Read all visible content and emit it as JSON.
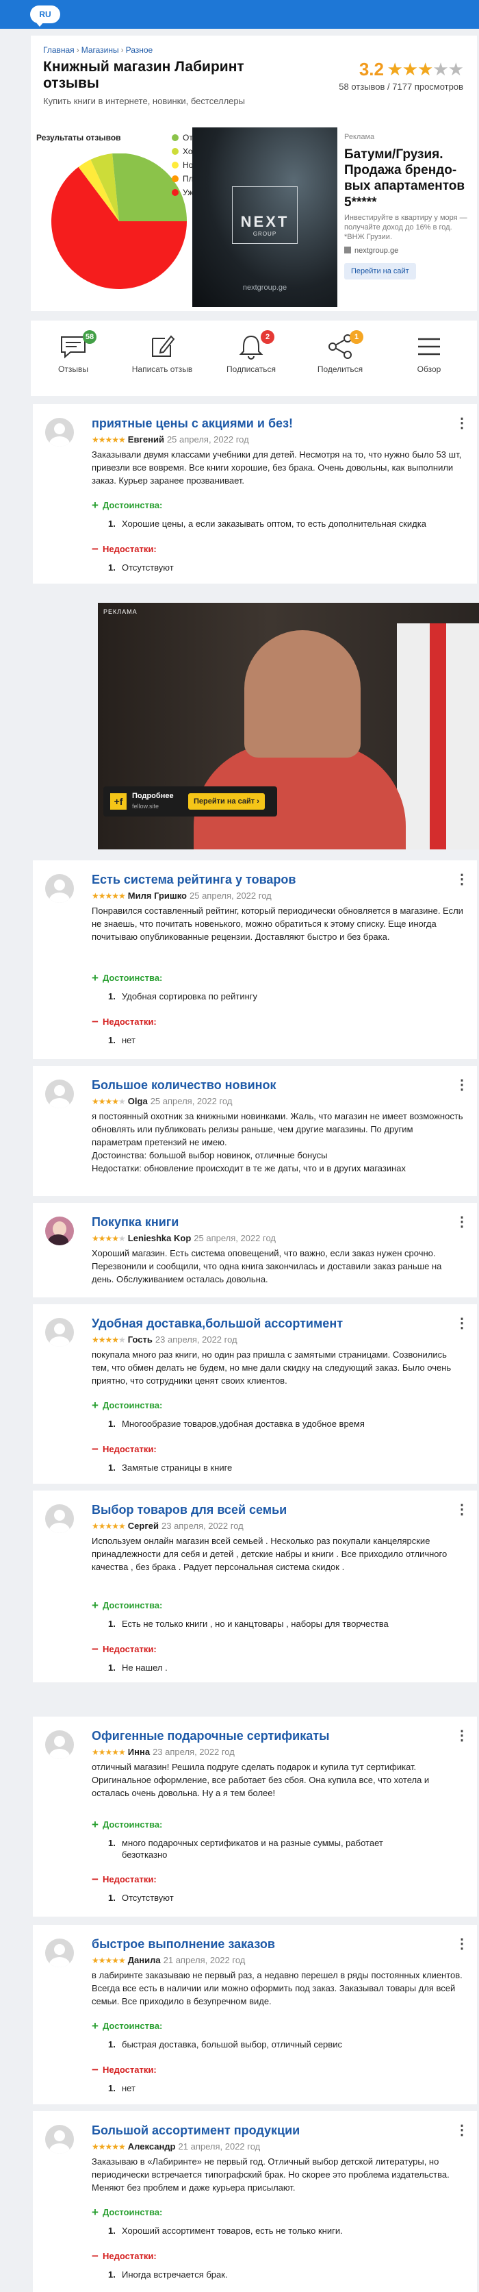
{
  "header": {
    "lang": "RU"
  },
  "store": {
    "breadcrumbs": [
      "Главная",
      "Магазины",
      "Разное"
    ],
    "title": "Книжный магазин Лабиринт отзывы",
    "subtitle": "Купить книги в интернете, новинки, бестселлеры",
    "rating": "3.2",
    "stars": 3,
    "reviews_count": "58 отзывов",
    "views": "7177 просмотров"
  },
  "results": {
    "title": "Результаты отзывов",
    "legend": [
      {
        "label": "Отлично",
        "color": "#8bc34a"
      },
      {
        "label": "Хорошо",
        "color": "#cddc39"
      },
      {
        "label": "Нормально",
        "color": "#ffeb3b"
      },
      {
        "label": "Плохо",
        "color": "#ff9800"
      },
      {
        "label": "Ужасно",
        "color": "#f51d1d"
      }
    ]
  },
  "ad_banner": {
    "label": "Реклама",
    "logo": "NEXT",
    "logo_sub": "GROUP",
    "image_url_text": "nextgroup.ge",
    "headline": "Батуми/Грузия. Продажа брендо­вых апартамен­тов 5*****",
    "body": "Инвестируйте в квартиру у моря — получайте доход до 16% в год. *ВНЖ Грузии.",
    "site": "nextgroup.ge",
    "button": "Перейти на сайт"
  },
  "actions": [
    {
      "label": "Отзывы",
      "icon": "comment-icon",
      "badge": "58",
      "badge_color": "#43a047"
    },
    {
      "label": "Написать отзыв",
      "icon": "pencil-icon"
    },
    {
      "label": "Подписаться",
      "icon": "bell-icon",
      "badge": "2",
      "badge_color": "#e53935"
    },
    {
      "label": "Поделиться",
      "icon": "share-icon",
      "badge": "1",
      "badge_color": "#f5a623"
    },
    {
      "label": "Обзор",
      "icon": "hamburger-icon"
    }
  ],
  "video_ad": {
    "label": "РЕКЛАМА",
    "more": "Подробнее",
    "more_sub": "fellow.site",
    "button": "Перейти на сайт",
    "icon_text": "+f"
  },
  "labels": {
    "pros": "Достоинства:",
    "cons": "Недостатки:"
  },
  "reviews": [
    {
      "title": "приятные цены с акциями и без!",
      "stars": 5,
      "author": "Евгений",
      "date": "25 апреля, 2022 год",
      "body": "Заказывали двумя классами учебники для детей. Несмотря на то, что нужно было 53 шт, привезли все вовремя. Все книги хорошие, без брака. Очень довольны, как выполнили заказ. Курьер заранее прозванивает.",
      "pros": [
        "Хорошие цены, а если заказывать оптом, то есть дополнительная скидка"
      ],
      "cons": [
        "Отсутствуют"
      ]
    },
    {
      "title": "Есть система рейтинга у товаров",
      "stars": 5,
      "author": "Миля Гришко",
      "date": "25 апреля, 2022 год",
      "body": "Понравился составленный рейтинг, который периодически обновляется в магазине. Если не знаешь, что почитать новенького, можно обратиться к этому списку. Еще иногда почитываю опубликованные рецензии. Доставляют быстро и без брака.",
      "pros": [
        "Удобная сортировка по рейтингу"
      ],
      "cons": [
        "нет"
      ]
    },
    {
      "title": "Большое количество новинок",
      "stars": 4,
      "author": "Olga",
      "date": "25 апреля, 2022 год",
      "body": "я постоянный охотник за книжными новинками. Жаль, что магазин не имеет возможность обновлять или публиковать релизы раньше, чем другие магазины. По другим параметрам претензий не имею.\nДостоинства: большой выбор новинок, отличные бонусы\nНедостатки: обновление происходит в те же даты, что и в других магазинах"
    },
    {
      "title": "Покупка книги",
      "stars": 4,
      "author": "Lenieshka Kop",
      "date": "25 апреля, 2022 год",
      "body": "Хороший магазин. Есть система оповещений, что важно, если заказ нужен срочно. Перезвонили и сообщили, что одна книга закончилась и доставили заказ раньше на день. Обслуживанием осталась довольна."
    },
    {
      "title": "Удобная доставка,большой ассортимент",
      "stars": 4,
      "author": "Гость",
      "date": "23 апреля, 2022 год",
      "body": "покупала много раз книги, но один раз пришла с замятыми страницами. Созвонились тем, что обмен делать не будем, но мне дали скидку на следующий заказ. Было очень приятно, что сотрудники ценят своих клиентов.",
      "pros": [
        "Многообразие товаров,удобная доставка в удобное время"
      ],
      "cons": [
        "Замятые страницы в книге"
      ]
    },
    {
      "title": "Выбор товаров для всей семьи",
      "stars": 5,
      "author": "Сергей",
      "date": "23 апреля, 2022 год",
      "body": "Используем онлайн магазин всей семьей . Несколько раз покупали канцелярские принадлежности для себя и детей , детские набры и книги . Все приходило отличного качества , без брака . Радует персональная система скидок .",
      "pros": [
        "Есть не только книги , но и канцтовары , наборы для творчества"
      ],
      "cons": [
        "Не нашел ."
      ]
    },
    {
      "title": "Офигенные подарочные сертификаты",
      "stars": 5,
      "author": "Инна",
      "date": "23 апреля, 2022 год",
      "body": "отличный магазин! Решила подруге сделать подарок и купила тут сертификат. Оригинальное оформление, все работает без сбоя. Она купила все, что хотела и осталась очень довольна. Ну а я тем более!",
      "pros": [
        "много подарочных сертификатов и на разные суммы, работает безотказно"
      ],
      "cons": [
        "Отсутствуют"
      ]
    },
    {
      "title": "быстрое выполнение заказов",
      "stars": 5,
      "author": "Данила",
      "date": "21 апреля, 2022 год",
      "body": "в лабиринте заказываю не первый раз, а недавно перешел в ряды постоянных клиентов. Всегда все есть в наличии или можно оформить под заказ. Заказывал товары для всей семьи. Все приходило в безупречном виде.",
      "pros": [
        "быстрая доставка, большой выбор, отличный сервис"
      ],
      "cons": [
        "нет"
      ]
    },
    {
      "title": "Большой ассортимент продукции",
      "stars": 5,
      "author": "Александр",
      "date": "21 апреля, 2022 год",
      "body": "Заказываю в «Лабиринте» не первый год. Отличный выбор детской литературы, но периодически встречается типографский брак. Но скорее это проблема издательства. Меняют без проблем и даже курьера присылают.",
      "pros": [
        "Хороший ассортимент товаров, есть не только книги."
      ],
      "cons": [
        "Иногда встречается брак."
      ]
    }
  ]
}
